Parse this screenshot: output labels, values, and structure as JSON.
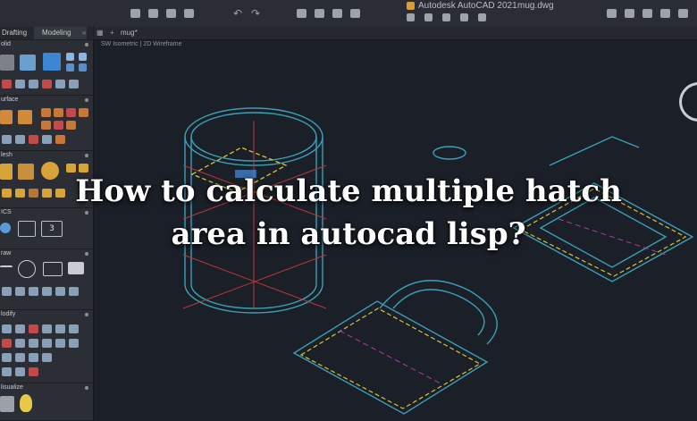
{
  "app": {
    "title": "Autodesk AutoCAD 2021",
    "file": "mug.dwg"
  },
  "left_panel": {
    "tabs": [
      "Drafting",
      "Modeling"
    ],
    "sections": [
      "olid",
      "urface",
      "lesh",
      "ICS",
      "raw",
      "lodify",
      "lisualize"
    ],
    "ics_button_label": "3"
  },
  "drawing": {
    "tab": "mug*",
    "viewport_label": "SW Isometric | 2D Wireframe"
  },
  "headline": {
    "line1": "How to calculate multiple hatch",
    "line2": "area in autocad lisp?"
  },
  "colors": {
    "background": "#1b1f27",
    "panel": "#2b2e34",
    "cyan_lines": "#3aa0b8",
    "yellow_dashed": "#d8c53a",
    "magenta_dashed": "#b03aa8",
    "red_lines": "#b83a3a"
  }
}
